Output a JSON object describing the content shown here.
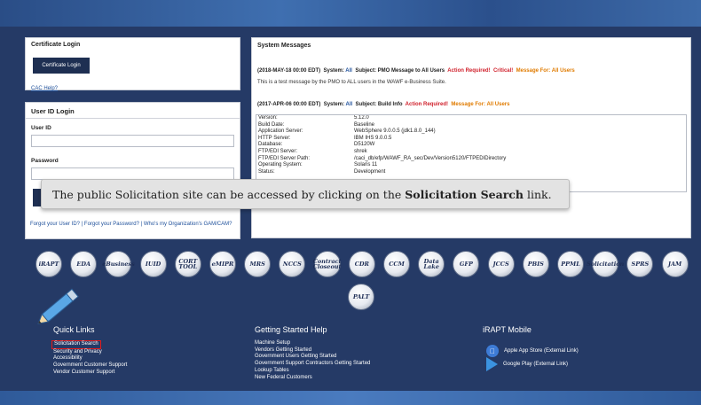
{
  "certificate_login": {
    "title": "Certificate Login",
    "button": "Certificate Login",
    "cac_help": "CAC Help?"
  },
  "user_login": {
    "title": "User ID Login",
    "user_id_label": "User ID",
    "password_label": "Password",
    "forgot_text": "Forgot your User ID? | Forgot your Password? | Who's my Organization's GAM/CAM?"
  },
  "system_messages": {
    "title": "System Messages",
    "msg1": {
      "date": "(2018-MAY-18 00:00 EDT)",
      "system_label": "System:",
      "system_value": "All",
      "subject": "Subject: PMO Message to All Users",
      "action": "Action Required!",
      "critical": "Critical!",
      "for": "Message For: All Users",
      "body": "This is a test message by the PMO to ALL users in the WAWF e-Business Suite."
    },
    "msg2": {
      "date": "(2017-APR-06 00:00 EDT)",
      "system_label": "System:",
      "system_value": "All",
      "subject": "Subject: Build Info",
      "action": "Action Required!",
      "for": "Message For: All Users"
    },
    "build_info": [
      {
        "key": "Version:",
        "value": "5.12.0"
      },
      {
        "key": "Build Date:",
        "value": "Baseline"
      },
      {
        "key": "Application Server:",
        "value": "WebSphere 9.0.0.5 (jdk1.8.0_144)"
      },
      {
        "key": "HTTP Server:",
        "value": "IBM IHS 9.0.0.5"
      },
      {
        "key": "Database:",
        "value": "D5120W"
      },
      {
        "key": "FTP/EDI Server:",
        "value": "shrek"
      },
      {
        "key": "FTP/EDI Server Path:",
        "value": "/caci_db/efp/WAWF_RA_sec/Dev/Version5120/FTPEDIDirectory"
      },
      {
        "key": "Operating System:",
        "value": "Solaris 11"
      },
      {
        "key": "Status:",
        "value": "Development"
      }
    ]
  },
  "tooltip": {
    "text_before": "The public Solicitation site can be accessed by clicking on the ",
    "bold": "Solicitation Search",
    "text_after": " link."
  },
  "app_icons": [
    "iRAPT",
    "EDA",
    "eBusiness",
    "IUID",
    "CORT TOOL",
    "eMIPR",
    "MRS",
    "NCCS",
    "Contract Closeout",
    "CDR",
    "CCM",
    "Data Lake",
    "GFP",
    "JCCS",
    "PBIS",
    "PPML",
    "Solicitation",
    "SPRS",
    "JAM",
    "PALT"
  ],
  "footer": {
    "quick_links": {
      "title": "Quick Links",
      "links": [
        "Solicitation Search",
        "Security and Privacy",
        "Accessibility",
        "Government Customer Support",
        "Vendor Customer Support"
      ]
    },
    "getting_started": {
      "title": "Getting Started Help",
      "links": [
        "Machine Setup",
        "Vendors Getting Started",
        "Government Users Getting Started",
        "Government Support Contractors Getting Started",
        "Lookup Tables",
        "New Federal Customers"
      ]
    },
    "mobile": {
      "title": "iRAPT Mobile",
      "apple": "Apple App Store (External Link)",
      "google": "Google Play (External Link)"
    }
  }
}
